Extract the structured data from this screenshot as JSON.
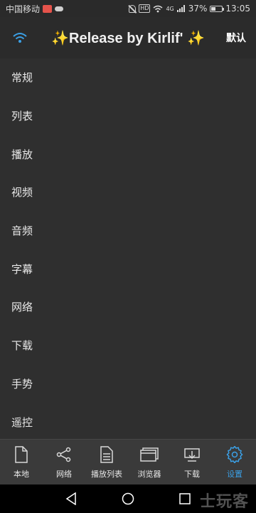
{
  "status_bar": {
    "carrier": "中国移动",
    "hd": "HD",
    "signal": "4G",
    "battery_percent": "37%",
    "battery_level": 0.37,
    "time": "13:05"
  },
  "header": {
    "title": "✨Release by Kirlif' ✨",
    "default_button": "默认"
  },
  "settings": {
    "items": [
      {
        "label": "常规"
      },
      {
        "label": "列表"
      },
      {
        "label": "播放"
      },
      {
        "label": "视频"
      },
      {
        "label": "音频"
      },
      {
        "label": "字幕"
      },
      {
        "label": "网络"
      },
      {
        "label": "下载"
      },
      {
        "label": "手势"
      },
      {
        "label": "遥控"
      }
    ]
  },
  "bottom_nav": {
    "tabs": [
      {
        "label": "本地",
        "icon": "file-icon"
      },
      {
        "label": "网络",
        "icon": "share-icon"
      },
      {
        "label": "播放列表",
        "icon": "document-list-icon"
      },
      {
        "label": "浏览器",
        "icon": "browser-window-icon"
      },
      {
        "label": "下载",
        "icon": "download-tray-icon"
      },
      {
        "label": "设置",
        "icon": "gear-icon"
      }
    ],
    "active_index": 5,
    "active_color": "#3ba0e6"
  },
  "watermark": "士玩客",
  "colors": {
    "background": "#2f2f2f",
    "accent": "#3ba0e6"
  }
}
